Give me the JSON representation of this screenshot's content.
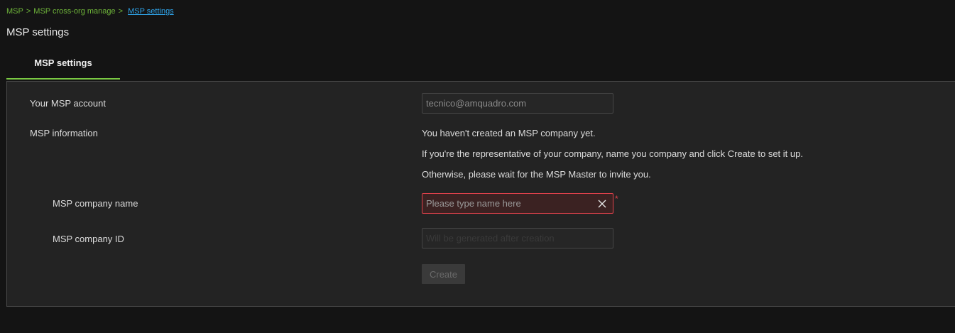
{
  "breadcrumb": {
    "items": [
      "MSP",
      "MSP cross-org manage"
    ],
    "separator": ">",
    "current": "MSP settings"
  },
  "page_title": "MSP settings",
  "tabs": [
    {
      "label": "MSP settings",
      "active": true
    }
  ],
  "form": {
    "account_label": "Your MSP account",
    "account_value": "tecnico@amquadro.com",
    "info_label": "MSP information",
    "info_lines": [
      "You haven't created an MSP company yet.",
      "If you're the representative of your company, name you company and click Create to set it up.",
      "Otherwise, please wait for the MSP Master to invite you."
    ],
    "company_name_label": "MSP company name",
    "company_name_placeholder": "Please type name here",
    "company_name_value": "",
    "required_mark": "*",
    "company_id_label": "MSP company ID",
    "company_id_placeholder": "Will be generated after creation",
    "create_label": "Create"
  },
  "colors": {
    "accent_green": "#7ac943",
    "link_blue": "#2fa3e8",
    "error_red": "#e0414b"
  },
  "icons": {
    "clear": "close-icon"
  }
}
